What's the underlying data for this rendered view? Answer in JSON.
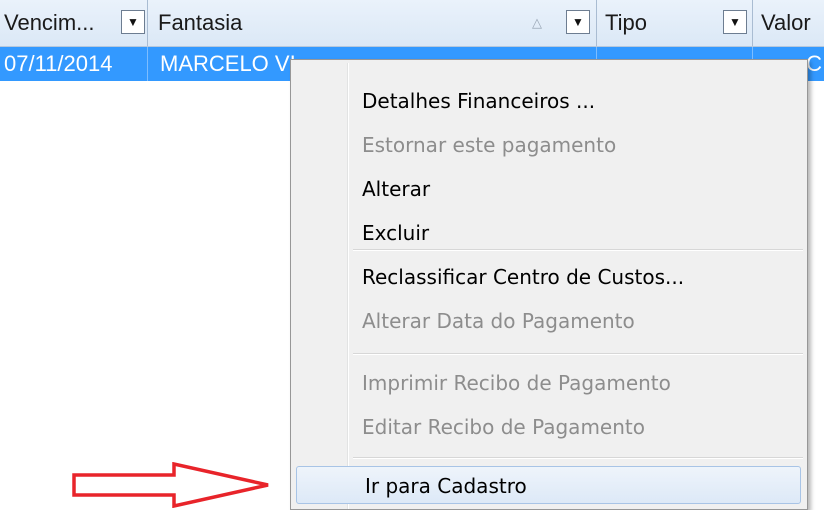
{
  "grid": {
    "columns": [
      {
        "label": "Vencim...",
        "dropdown_glyph": "▼"
      },
      {
        "label": "Fantasia",
        "sort_glyph": "△",
        "dropdown_glyph": "▼"
      },
      {
        "label": "Tipo",
        "dropdown_glyph": "▼"
      },
      {
        "label": "Valor"
      }
    ],
    "selected_row": {
      "vencimento": "07/11/2014",
      "fantasia": "MARCELO VI",
      "tipo": "",
      "valor": "C"
    },
    "row_color": "#3399ff"
  },
  "context_menu": {
    "items": [
      {
        "label": "Detalhes Financeiros ...",
        "enabled": true
      },
      {
        "label": "Estornar este pagamento",
        "enabled": false
      },
      {
        "label": "Alterar",
        "enabled": true
      },
      {
        "label": "Excluir",
        "enabled": true
      },
      {
        "label": "Reclassificar Centro de Custos...",
        "enabled": true
      },
      {
        "label": "Alterar Data do Pagamento",
        "enabled": false
      },
      {
        "label": "Imprimir Recibo de Pagamento",
        "enabled": false
      },
      {
        "label": "Editar Recibo de Pagamento",
        "enabled": false
      },
      {
        "label": "Ir para Cadastro",
        "enabled": true,
        "highlighted": true
      }
    ]
  },
  "annotation": {
    "icon": "red-outline-arrow-right-icon",
    "color": "#e8242a"
  }
}
